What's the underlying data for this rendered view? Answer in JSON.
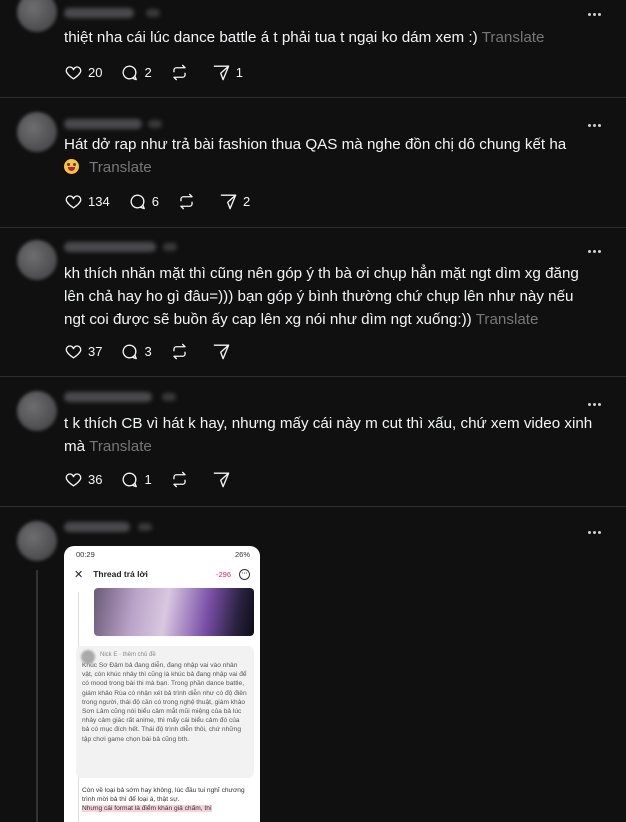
{
  "posts": [
    {
      "text": "thiệt nha cái lúc dance battle á t phải tua t ngại ko dám xem :)",
      "translate": "Translate",
      "likes": "20",
      "replies": "2",
      "reposts": "",
      "shares": "1"
    },
    {
      "text": "Hát dở rap như trả bài fashion thua QAS mà nghe đồn chị dô chung kết ha",
      "emoji": "grinning-face-emoji",
      "translate": "Translate",
      "likes": "134",
      "replies": "6",
      "reposts": "",
      "shares": "2"
    },
    {
      "text": "kh thích nhăn mặt thì cũng nên góp ý th bà ơi chụp hẳn mặt ngt dìm xg đăng lên chả hay ho gì đâu=))) bạn góp ý bình thường chứ chụp lên như này nếu ngt coi được sẽ buồn ấy cap lên xg nói như dìm ngt xuống:))",
      "translate": "Translate",
      "likes": "37",
      "replies": "3",
      "reposts": "",
      "shares": ""
    },
    {
      "text": "t k thích CB vì hát k hay, nhưng mấy cái này m cut thì xấu, chứ xem video xinh mà",
      "translate": "Translate",
      "likes": "36",
      "replies": "1",
      "reposts": "",
      "shares": ""
    }
  ],
  "attachment": {
    "status_time": "00:29",
    "status_right": "26%",
    "header_title": "Thread trả lời",
    "header_count": "-296",
    "comment_meta": "Nick E · thêm chủ đề",
    "comment_body": "Khúc Sơ Đậm bả đang diễn, đang nhập vai vào nhân vật, còn khúc nhảy thì cũng là khúc bả đang nhập vai để có mood trong bài thi mà bạn. Trong phần dance battle, giám khảo Rùa có nhận xét bả trình diễn như có độ điên trong người, thái độ cần có trong nghệ thuật, giám khảo Sơn Lâm cũng nói biểu cảm mắt mũi miệng của bả lúc nhảy cảm giác rất anime, thì mấy cái biểu cảm đó của bả có mục đích hết. Thái độ trình diễn thôi, chứ những tập chơi game chọn bài bả cũng bth.",
    "caption_1": "Còn về loại bả sớm hay không, lúc đầu tui nghĩ chương trình mời bả thì để loại á, thật sự.",
    "caption_2": "Nhưng cái format là điểm khán giả chấm, thì"
  },
  "icons": {
    "like": "heart-icon",
    "reply": "comment-icon",
    "repost": "repost-icon",
    "share": "send-icon",
    "more": "more-icon"
  }
}
